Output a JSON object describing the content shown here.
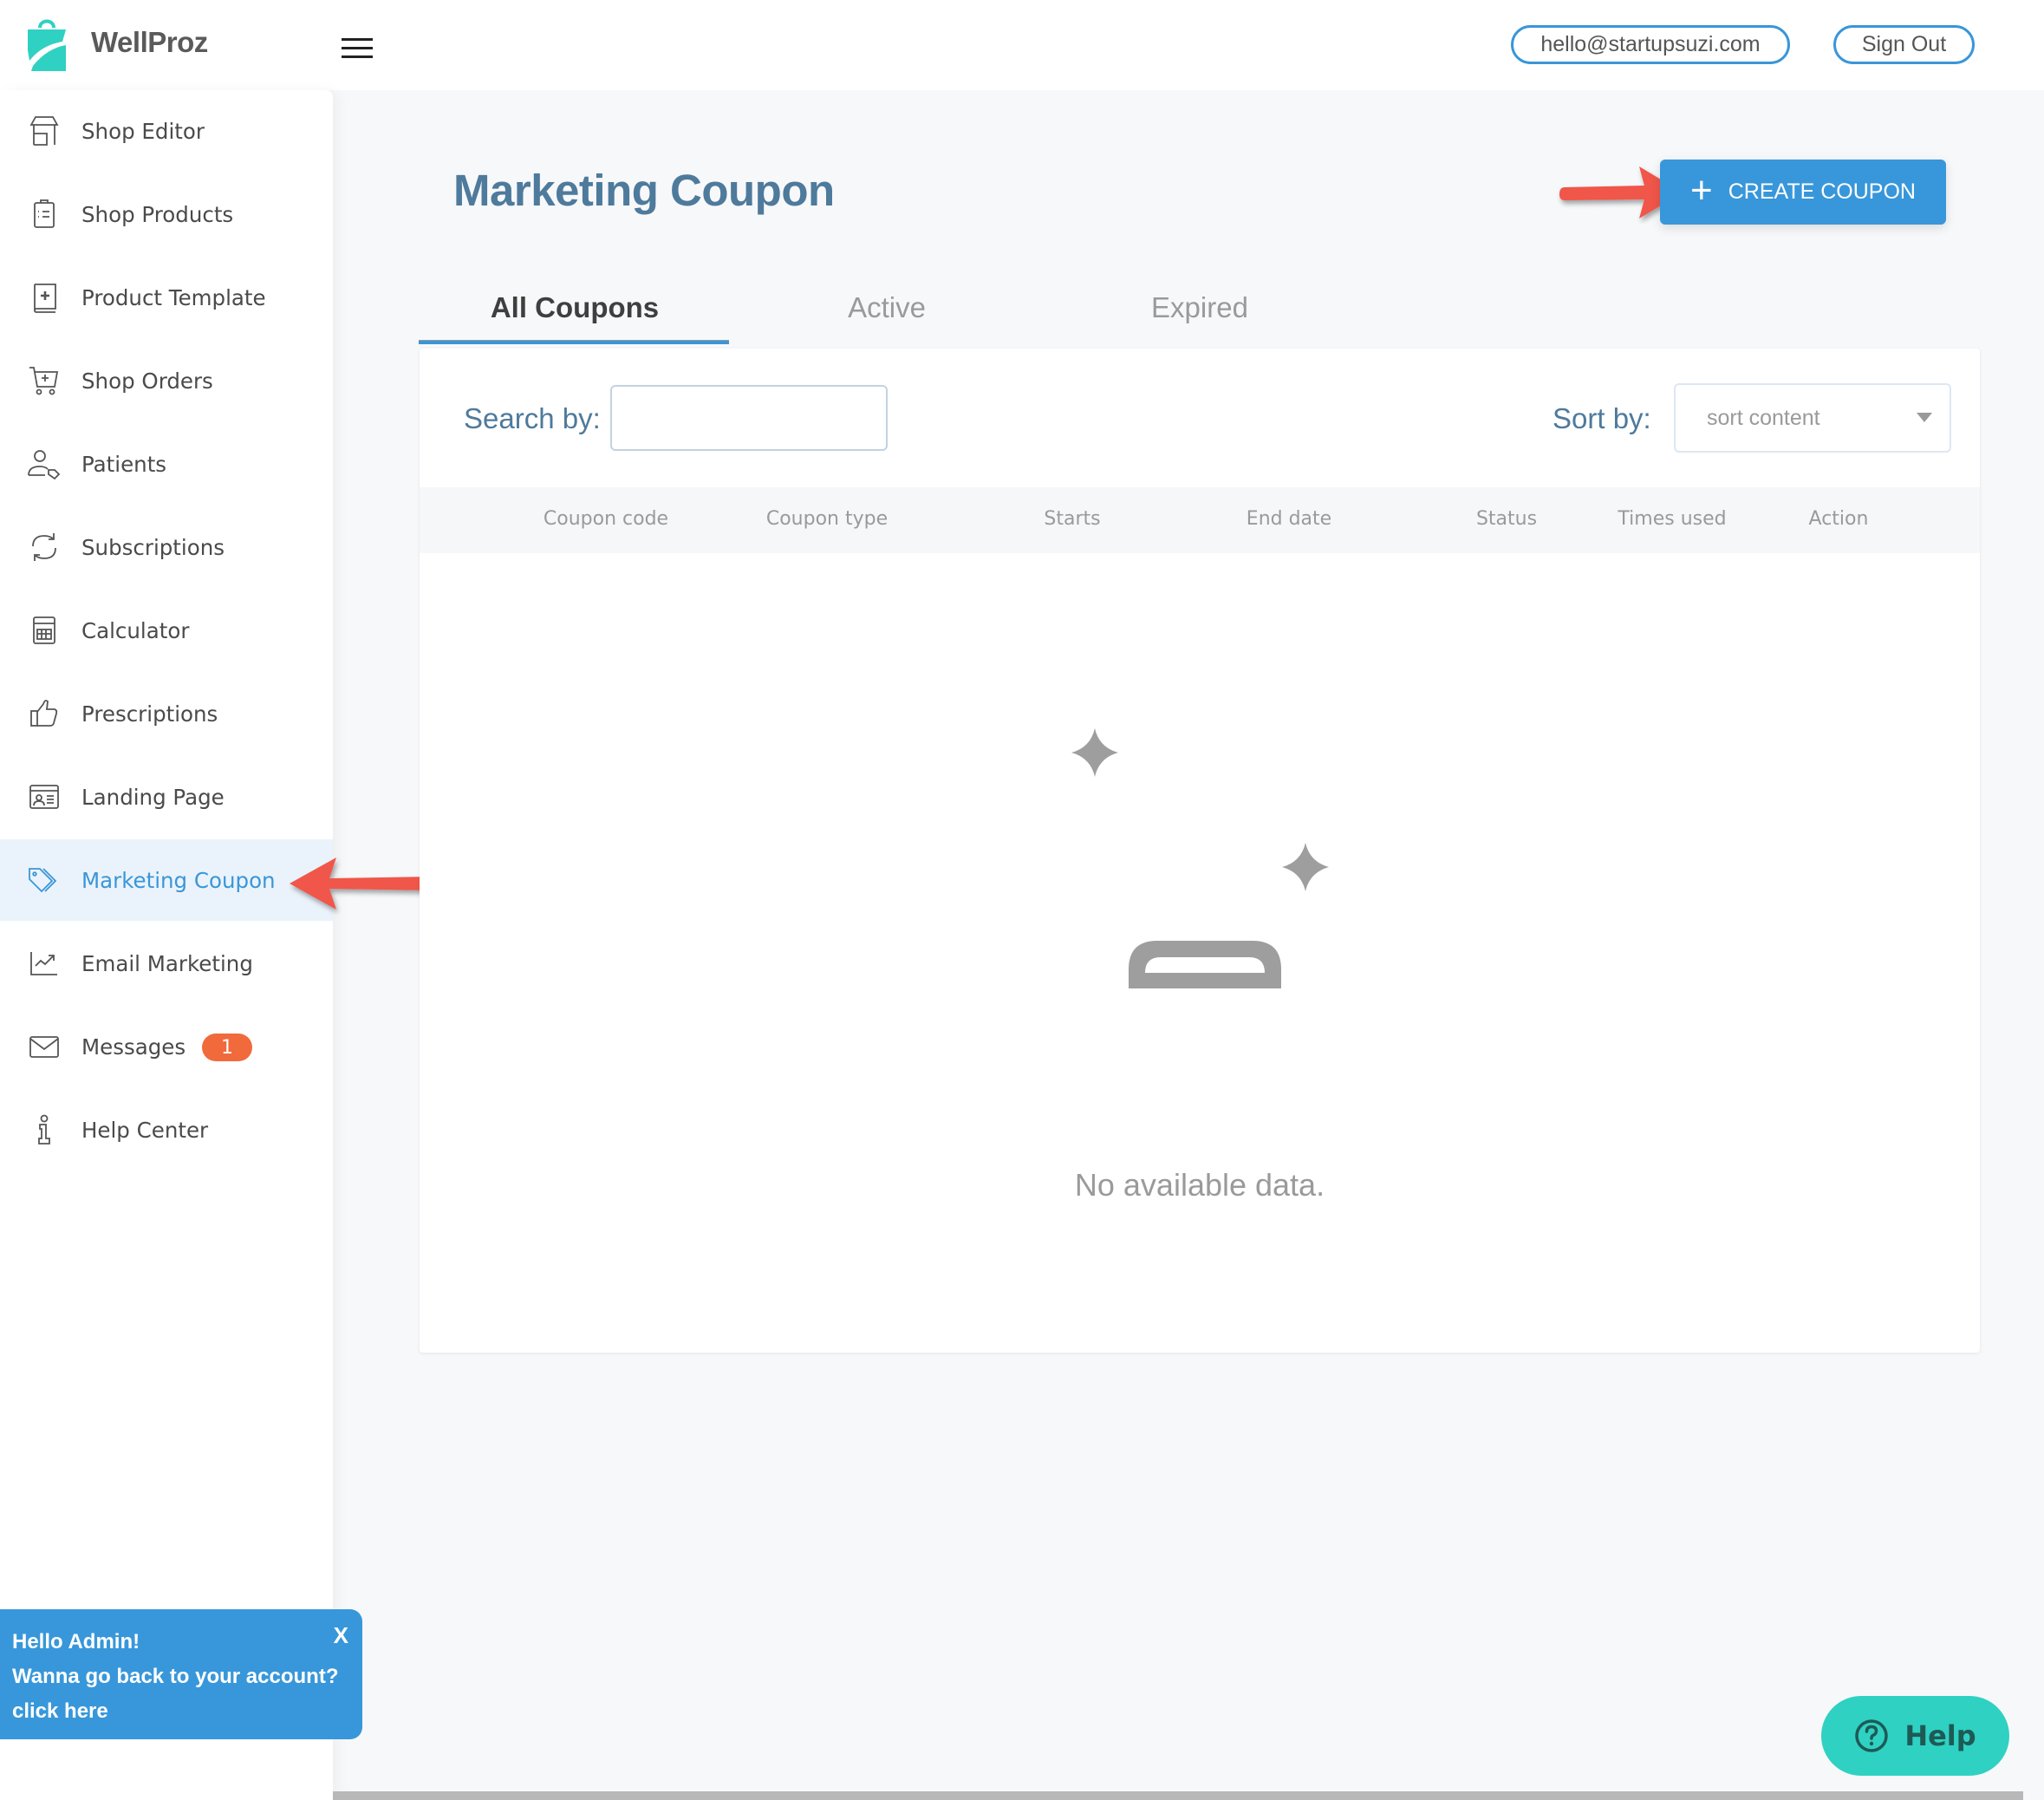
{
  "header": {
    "brand": "WellProz",
    "email": "hello@startupsuzi.com",
    "sign_out": "Sign Out"
  },
  "sidebar": {
    "items": [
      {
        "label": "Shop Editor",
        "icon": "storefront-icon"
      },
      {
        "label": "Shop Products",
        "icon": "clipboard-list-icon"
      },
      {
        "label": "Product Template",
        "icon": "book-plus-icon"
      },
      {
        "label": "Shop Orders",
        "icon": "cart-plus-icon"
      },
      {
        "label": "Patients",
        "icon": "user-tag-icon"
      },
      {
        "label": "Subscriptions",
        "icon": "refresh-icon"
      },
      {
        "label": "Calculator",
        "icon": "calculator-icon"
      },
      {
        "label": "Prescriptions",
        "icon": "thumbs-up-icon"
      },
      {
        "label": "Landing Page",
        "icon": "id-card-icon"
      },
      {
        "label": "Marketing Coupon",
        "icon": "tags-icon",
        "active": true
      },
      {
        "label": "Email Marketing",
        "icon": "chart-line-icon"
      },
      {
        "label": "Messages",
        "icon": "envelope-icon",
        "badge": "1"
      },
      {
        "label": "Help Center",
        "icon": "info-icon"
      }
    ]
  },
  "main": {
    "title": "Marketing Coupon",
    "create_button": "CREATE COUPON",
    "tabs": [
      {
        "label": "All Coupons",
        "active": true
      },
      {
        "label": "Active"
      },
      {
        "label": "Expired"
      }
    ],
    "search": {
      "label": "Search by:",
      "value": "",
      "placeholder": ""
    },
    "sort": {
      "label": "Sort by:",
      "value": "sort content"
    },
    "table": {
      "columns": [
        "Coupon code",
        "Coupon type",
        "Starts",
        "End date",
        "Status",
        "Times used",
        "Action"
      ],
      "rows": []
    },
    "empty_text": "No available data."
  },
  "toast": {
    "line1": "Hello Admin!",
    "line2": "Wanna go back to your account?",
    "link": "click here",
    "close": "X"
  },
  "help_button": "Help",
  "colors": {
    "accent": "#3897da",
    "title": "#4e7a9c",
    "badge": "#f06a3c",
    "help": "#2fd1c2",
    "annotation_arrow": "#f0564a"
  }
}
